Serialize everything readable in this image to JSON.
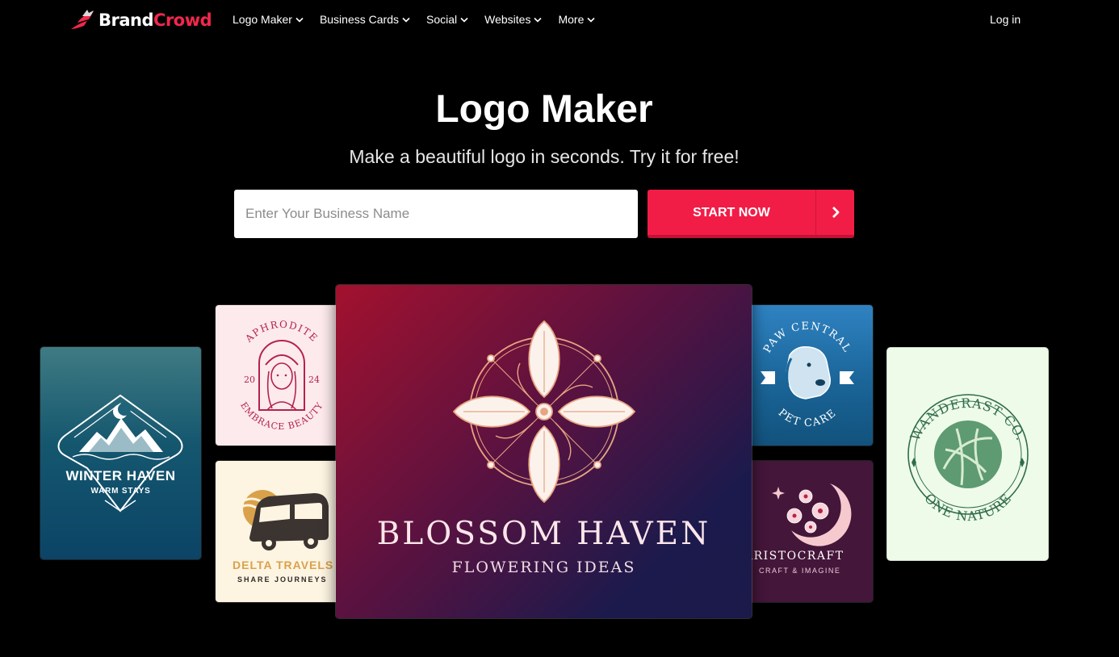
{
  "brand": {
    "name_part1": "Brand",
    "name_part2": "Crowd",
    "accent_color": "#f2274c"
  },
  "nav": {
    "items": [
      {
        "label": "Logo Maker"
      },
      {
        "label": "Business Cards"
      },
      {
        "label": "Social"
      },
      {
        "label": "Websites"
      },
      {
        "label": "More"
      }
    ],
    "login_label": "Log in"
  },
  "hero": {
    "title": "Logo Maker",
    "subtitle": "Make a beautiful logo in seconds. Try it for free!",
    "input_placeholder": "Enter Your Business Name",
    "input_value": "",
    "cta_label": "START NOW",
    "cta_color": "#f21d47"
  },
  "logos": {
    "winter": {
      "title": "WINTER HAVEN",
      "subtitle": "WARM STAYS"
    },
    "aphrodite": {
      "arc_top": "APHRODITE",
      "year_left": "20",
      "year_right": "24",
      "arc_bottom": "EMBRACE BEAUTY"
    },
    "delta": {
      "title": "DELTA TRAVELS",
      "subtitle": "SHARE JOURNEYS"
    },
    "blossom": {
      "title": "BLOSSOM HAVEN",
      "subtitle": "FLOWERING IDEAS"
    },
    "paw": {
      "arc_top": "PAW CENTRAL",
      "arc_bottom": "PET CARE"
    },
    "aristo": {
      "title": "ARISTOCRAFT",
      "subtitle": "CRAFT & IMAGINE"
    },
    "wanderast": {
      "arc_top": "WANDERAST CO.",
      "arc_bottom": "ONE NATURE"
    }
  }
}
